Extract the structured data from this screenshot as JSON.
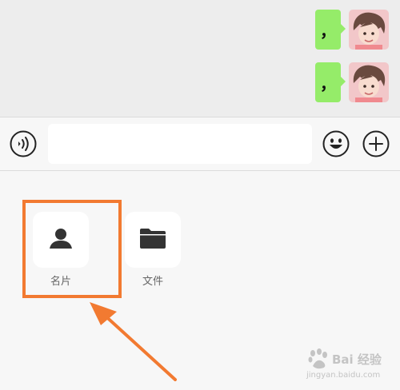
{
  "chat": {
    "messages": [
      {
        "text": "，"
      },
      {
        "text": "，"
      }
    ]
  },
  "input_bar": {
    "text_value": ""
  },
  "panel": {
    "items": [
      {
        "label": "名片",
        "icon": "contact-card-icon"
      },
      {
        "label": "文件",
        "icon": "folder-icon"
      }
    ]
  },
  "watermark": {
    "line1": "Bai 经验",
    "line2": "jingyan.baidu.com"
  },
  "colors": {
    "bubble": "#95ec69",
    "highlight": "#f27a31",
    "chat_bg": "#ededed",
    "panel_bg": "#f7f7f7"
  }
}
